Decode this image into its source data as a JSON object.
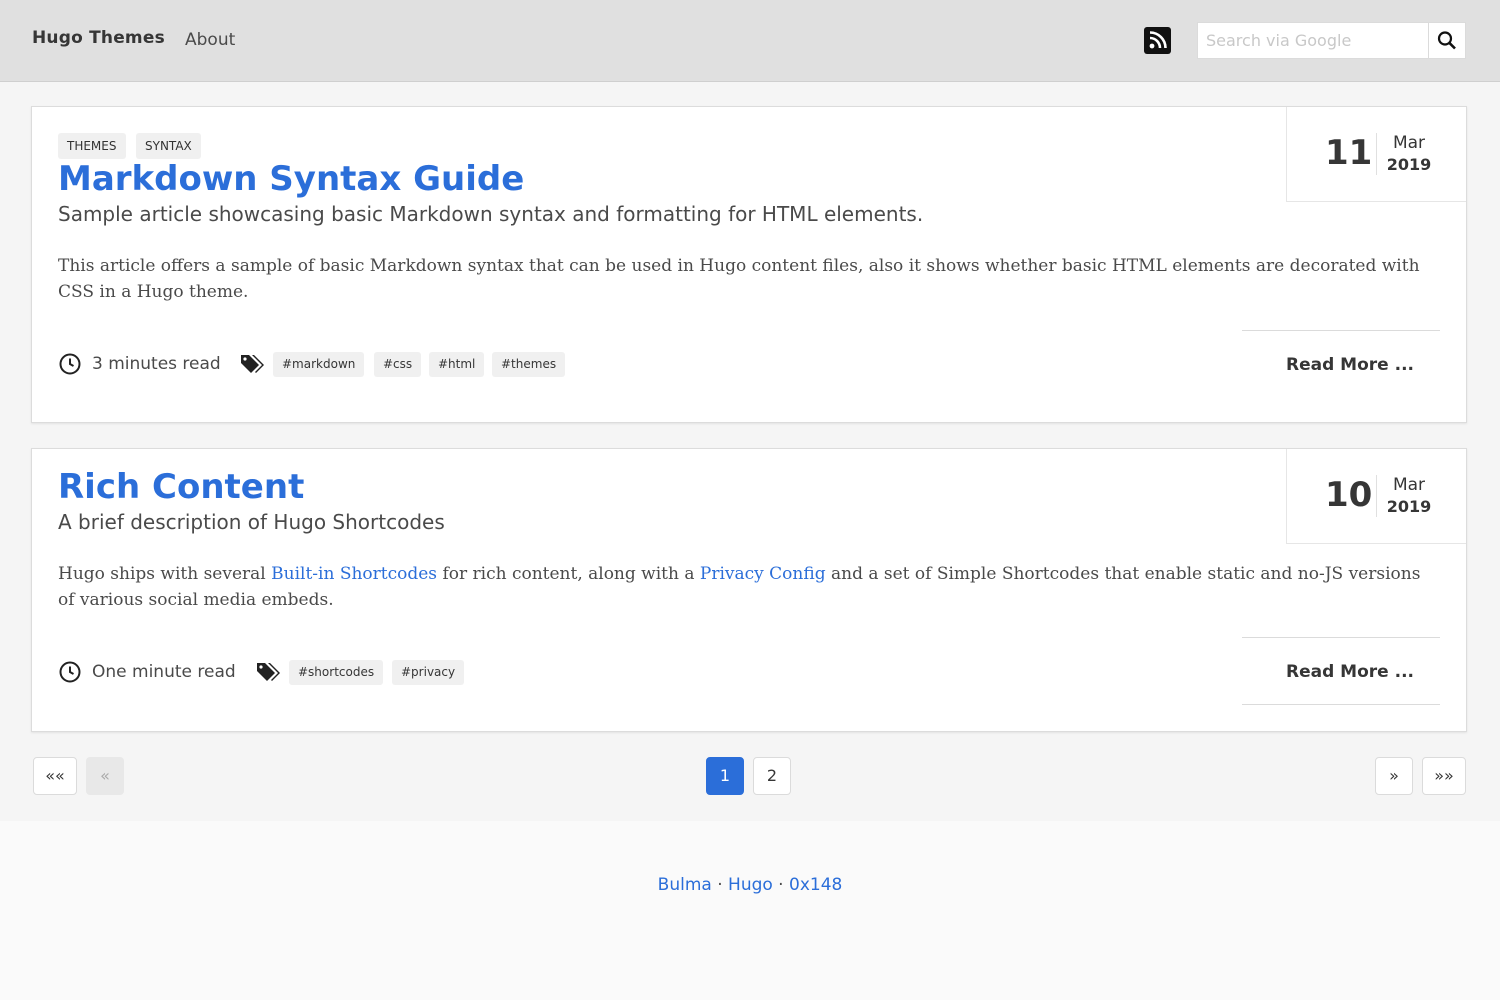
{
  "navbar": {
    "brand": "Hugo Themes",
    "about": "About",
    "rss_icon": "rss-icon",
    "search_placeholder": "Search via Google",
    "search_icon": "search-icon"
  },
  "posts": [
    {
      "categories": [
        "THEMES",
        "SYNTAX"
      ],
      "title": "Markdown Syntax Guide",
      "subtitle": "Sample article showcasing basic Markdown syntax and formatting for HTML elements.",
      "summary": "This article offers a sample of basic Markdown syntax that can be used in Hugo content files, also it shows whether basic HTML elements are decorated with CSS in a Hugo theme.",
      "day": "11",
      "month": "Mar",
      "year": "2019",
      "read_time": "3 minutes read",
      "tags": [
        "#markdown",
        "#css",
        "#html",
        "#themes"
      ],
      "read_more": "Read More ..."
    },
    {
      "categories": [],
      "title": "Rich Content",
      "subtitle": "A brief description of Hugo Shortcodes",
      "summary_parts": {
        "before": "Hugo ships with several ",
        "link1": "Built-in Shortcodes",
        "middle": " for rich content, along with a ",
        "link2": "Privacy Config",
        "after": " and a set of Simple Shortcodes that enable static and no-JS versions of various social media embeds."
      },
      "day": "10",
      "month": "Mar",
      "year": "2019",
      "read_time": "One minute read",
      "tags": [
        "#shortcodes",
        "#privacy"
      ],
      "read_more": "Read More ..."
    }
  ],
  "pagination": {
    "first": "««",
    "prev": "«",
    "pages": [
      "1",
      "2"
    ],
    "current": "1",
    "next": "»",
    "last": "»»"
  },
  "footer": {
    "link1": "Bulma",
    "sep1": " · ",
    "link2": "Hugo",
    "sep2": " · ",
    "link3": "0x148"
  },
  "colors": {
    "accent": "#2b6ed9",
    "navbar_bg": "#e0e0e0"
  }
}
